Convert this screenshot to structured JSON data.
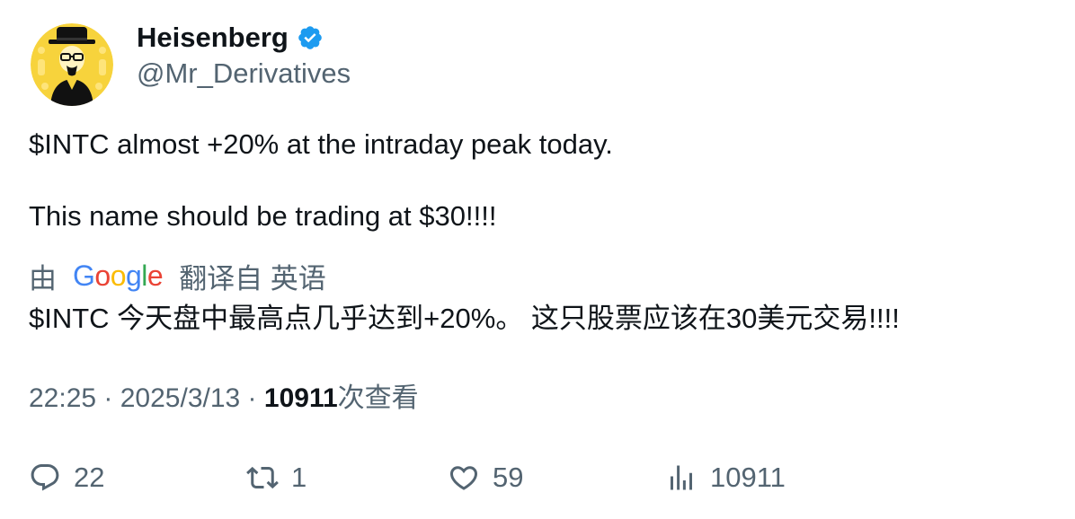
{
  "author": {
    "display_name": "Heisenberg",
    "handle": "@Mr_Derivatives",
    "verified": true,
    "avatar_icon": "heisenberg-avatar"
  },
  "tweet": {
    "line1": "$INTC almost +20% at the intraday peak today.",
    "line2": "This name should be trading at $30!!!!"
  },
  "translation": {
    "prefix": "由",
    "provider": "Google",
    "suffix": "翻译自 英语",
    "text": "$INTC 今天盘中最高点几乎达到+20%。 这只股票应该在30美元交易!!!!"
  },
  "meta": {
    "time": "22:25",
    "separator1": " · ",
    "date": "2025/3/13",
    "separator2": " · ",
    "views_count": "10911",
    "views_label": "次查看"
  },
  "actions": {
    "reply_count": "22",
    "retweet_count": "1",
    "like_count": "59",
    "views_count": "10911"
  },
  "colors": {
    "text_primary": "#0f1419",
    "text_secondary": "#536471",
    "verified_blue": "#1d9bf0",
    "avatar_yellow": "#f7d33c"
  }
}
